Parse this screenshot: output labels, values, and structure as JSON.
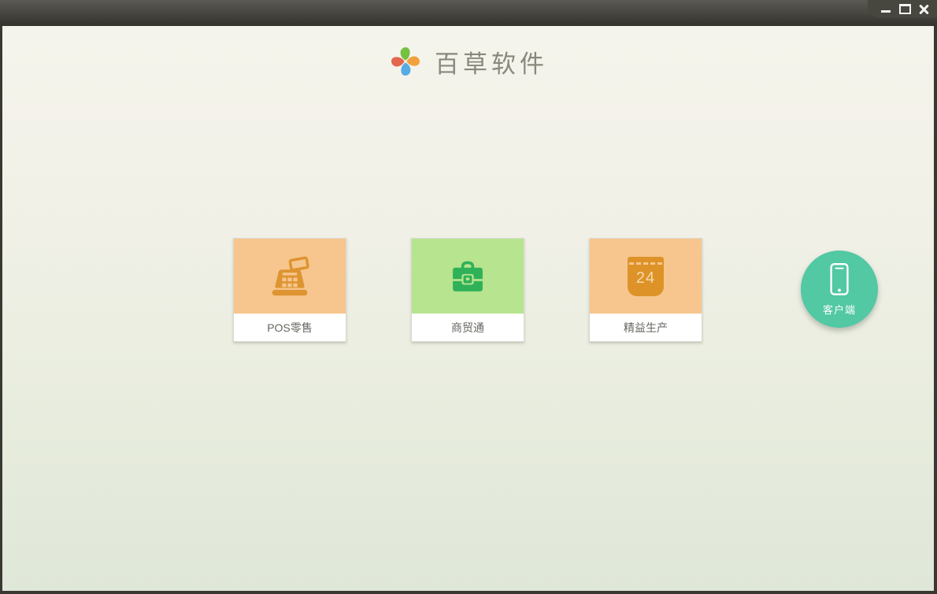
{
  "window": {
    "controls": [
      {
        "name": "minimize"
      },
      {
        "name": "maximize"
      },
      {
        "name": "close"
      }
    ],
    "titlebar_color": "#45443e"
  },
  "header": {
    "brand_name": "百草软件",
    "logo_petal_colors": {
      "top": "#76c043",
      "right": "#f2a13c",
      "bottom": "#58aae4",
      "left": "#e2654e"
    }
  },
  "products": [
    {
      "label": "POS零售",
      "icon": "cash-register-icon",
      "tile_color": "#f6c68e",
      "icon_color": "#de9430"
    },
    {
      "label": "商贸通",
      "icon": "briefcase-icon",
      "tile_color": "#b7e48f",
      "icon_color": "#2fb158"
    },
    {
      "label": "精益生产",
      "icon": "calendar-icon",
      "tile_color": "#f6c68e",
      "icon_color": "#dd9327",
      "calendar_day": "24"
    }
  ],
  "client_button": {
    "label": "客户端",
    "icon": "smartphone-icon",
    "color": "#52c8a3"
  },
  "colors": {
    "background_top": "#f5f4ec",
    "background_bottom": "#dfe7d9",
    "frame": "#393833"
  }
}
